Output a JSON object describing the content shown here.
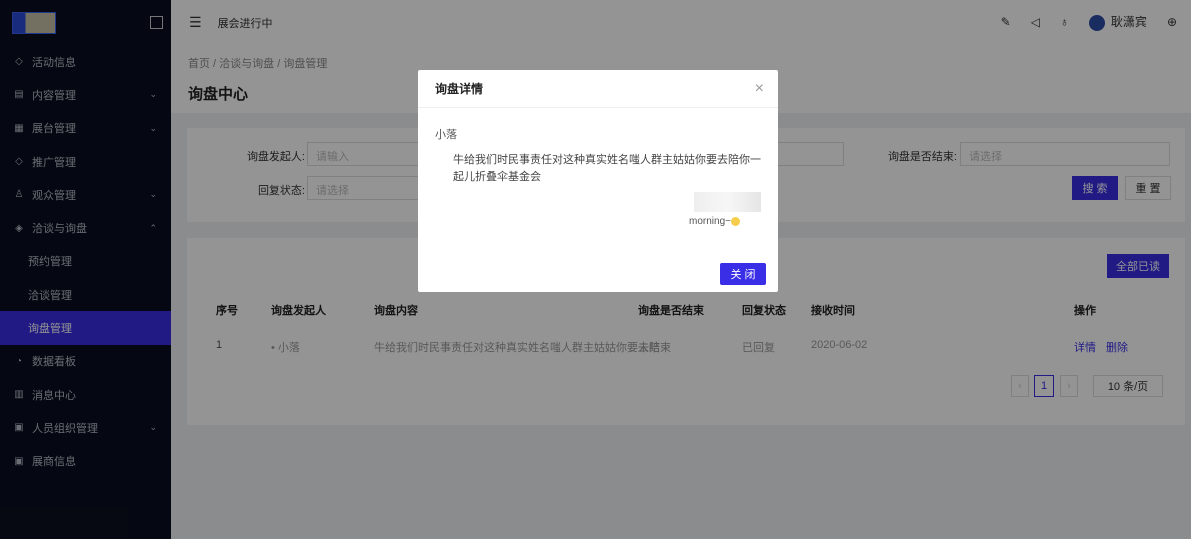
{
  "sidebar": {
    "items": [
      {
        "label": "活动信息",
        "icon": "◇"
      },
      {
        "label": "内容管理",
        "icon": "▤",
        "chev": "⌄"
      },
      {
        "label": "展台管理",
        "icon": "▦",
        "chev": "⌄"
      },
      {
        "label": "推广管理",
        "icon": "◇"
      },
      {
        "label": "观众管理",
        "icon": "♙",
        "chev": "⌄"
      },
      {
        "label": "洽谈与询盘",
        "icon": "◈",
        "chev": "⌃"
      },
      {
        "label": "预约管理",
        "sub": true
      },
      {
        "label": "洽谈管理",
        "sub": true
      },
      {
        "label": "询盘管理",
        "sub": true,
        "active": true
      },
      {
        "label": "数据看板",
        "icon": "◔"
      },
      {
        "label": "消息中心",
        "icon": "▥"
      },
      {
        "label": "人员组织管理",
        "icon": "▣",
        "chev": "⌄"
      },
      {
        "label": "展商信息",
        "icon": "▣"
      }
    ]
  },
  "topbar": {
    "title": "展会进行中",
    "user": "耿潇宾"
  },
  "breadcrumb": [
    "首页",
    "洽谈与询盘",
    "询盘管理"
  ],
  "page_title": "询盘中心",
  "search": {
    "initiator_label": "询盘发起人:",
    "initiator_placeholder": "请输入",
    "reply_label": "回复状态:",
    "reply_placeholder": "请选择",
    "ended_label": "询盘是否结束:",
    "ended_placeholder": "请选择",
    "search_btn": "搜 索",
    "reset_btn": "重 置"
  },
  "table": {
    "mark_all_btn": "全部已读",
    "headers": [
      "序号",
      "询盘发起人",
      "询盘内容",
      "询盘是否结束",
      "回复状态",
      "接收时间",
      "操作"
    ],
    "rows": [
      {
        "no": "1",
        "initiator": "• 小落",
        "content": "牛给我们时民事责任对这种真实姓名嗤人群主姑姑你要去陪",
        "ended": "未结束",
        "reply": "已回复",
        "time": "2020-06-02",
        "detail": "详情",
        "delete": "删除"
      }
    ]
  },
  "pagination": {
    "current": "1",
    "page_size": "10 条/页"
  },
  "modal": {
    "title": "询盘详情",
    "name": "小落",
    "message": "牛给我们时民事责任对这种真实姓名嗤人群主姑姑你要去陪你一起儿折叠伞基金会",
    "reply": "morning~",
    "close_btn": "关 闭"
  }
}
